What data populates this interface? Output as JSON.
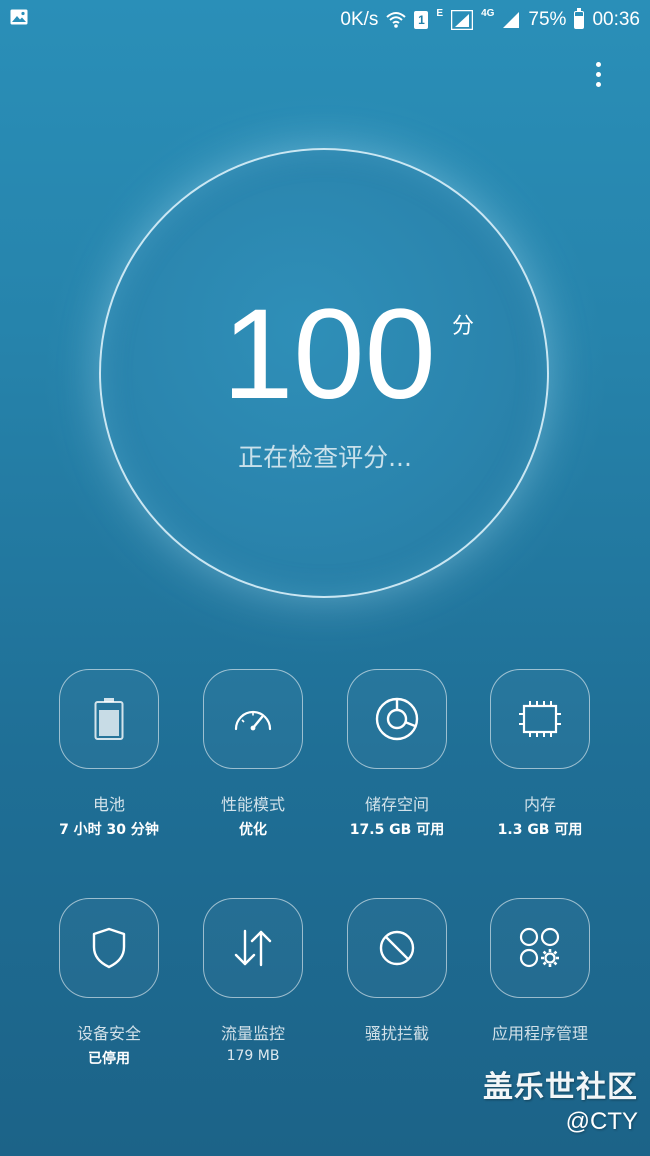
{
  "status_bar": {
    "net_speed": "0K/s",
    "sim_slot": "1",
    "network_e": "E",
    "network_4g": "4G",
    "battery_percent": "75%",
    "battery_level": 0.75,
    "time": "00:36",
    "left_icon": "image-icon"
  },
  "score": {
    "value": "100",
    "unit": "分",
    "status": "正在检查评分..."
  },
  "tiles": [
    {
      "label": "电池",
      "sub": "7 小时 30 分钟",
      "icon": "battery-icon"
    },
    {
      "label": "性能模式",
      "sub": "优化",
      "icon": "speedometer-icon"
    },
    {
      "label": "储存空间",
      "sub": "17.5 GB 可用",
      "icon": "storage-icon"
    },
    {
      "label": "内存",
      "sub": "1.3 GB 可用",
      "icon": "memory-chip-icon"
    },
    {
      "label": "设备安全",
      "sub": "已停用",
      "icon": "shield-icon"
    },
    {
      "label": "流量监控",
      "sub": "179 MB",
      "icon": "data-transfer-icon"
    },
    {
      "label": "骚扰拦截",
      "sub": "",
      "icon": "block-icon"
    },
    {
      "label": "应用程序管理",
      "sub": "",
      "icon": "app-manager-icon"
    }
  ],
  "watermark": {
    "line1": "盖乐世社区",
    "line2": "@CTY"
  }
}
